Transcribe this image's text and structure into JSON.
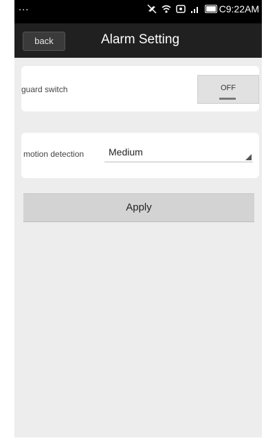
{
  "status_bar": {
    "dots": "...",
    "time": "C9:22AM",
    "icons": [
      "mute-icon",
      "wifi-icon",
      "sync-icon",
      "signal-icon",
      "battery-icon"
    ]
  },
  "header": {
    "back_label": "back",
    "title": "Alarm Setting"
  },
  "guard": {
    "label": "guard switch",
    "toggle_text": "OFF"
  },
  "motion": {
    "label": "motion detection",
    "value": "Medium"
  },
  "apply_label": "Apply",
  "colors": {
    "background": "#ededed",
    "titlebar": "#202020",
    "card": "#ffffff",
    "apply_button": "#d3d3d3"
  }
}
